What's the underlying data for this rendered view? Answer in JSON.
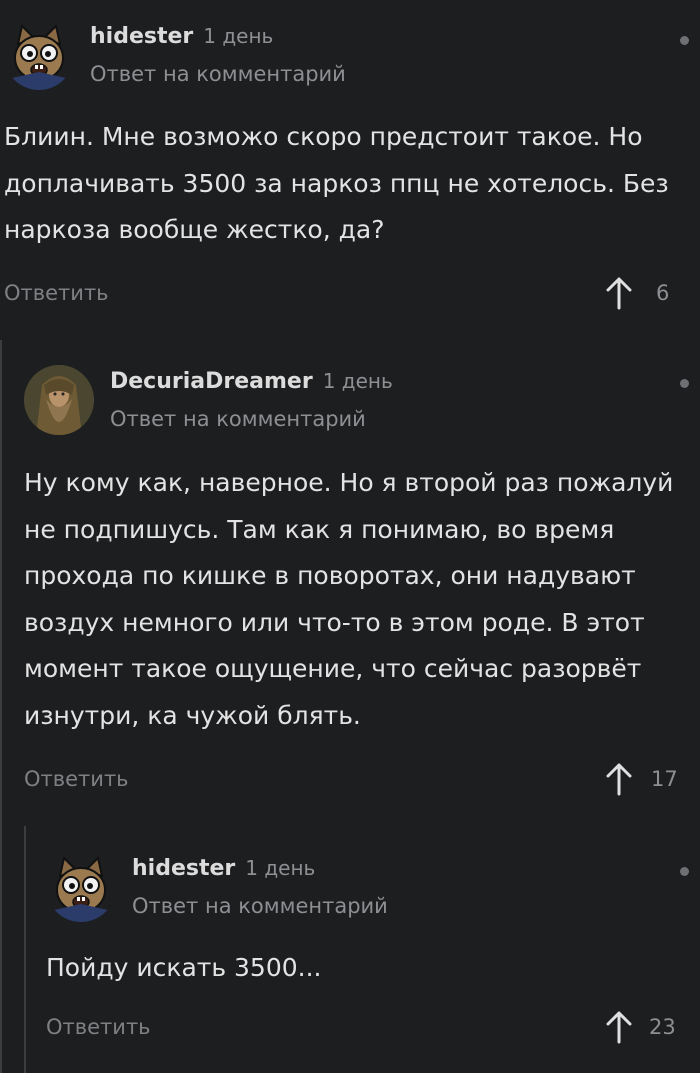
{
  "comments": [
    {
      "author": "hidester",
      "time": "1 день",
      "reply_to": "Ответ на комментарий",
      "body": "Блиин. Мне возможо скоро предстоит такое. Но\nдоплачивать 3500 за наркоз ппц не хотелось. Без\nнаркоза вообще жестко, да?",
      "reply_label": "Ответить",
      "votes": "6",
      "avatar": "cat-avatar"
    },
    {
      "author": "DecuriaDreamer",
      "time": "1 день",
      "reply_to": "Ответ на комментарий",
      "body": "Ну кому как, наверное. Но я второй раз пожалуй\nне подпишусь. Там как я понимаю, во время\nпрохода по кишке в поворотах, они надувают\nвоздух немного или что-то в этом роде. В этот\nмомент такое ощущение, что сейчас разорвёт\nизнутри, ка чужой блять.",
      "reply_label": "Ответить",
      "votes": "17",
      "avatar": "wizard-avatar"
    },
    {
      "author": "hidester",
      "time": "1 день",
      "reply_to": "Ответ на комментарий",
      "body": "Пойду искать 3500...",
      "reply_label": "Ответить",
      "votes": "23",
      "avatar": "cat-avatar"
    }
  ],
  "colors": {
    "background": "#1d1e20",
    "thread_line": "#3c3d40",
    "muted_text": "#8e8f92"
  }
}
